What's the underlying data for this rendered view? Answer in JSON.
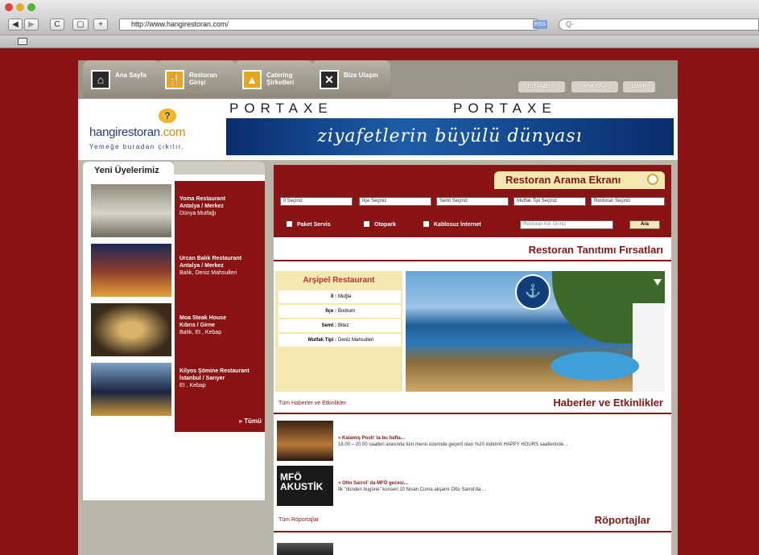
{
  "browser": {
    "url": "http://www.hangirestoran.com/",
    "search_placeholder": "Q-",
    "rss_label": "RSS",
    "back": "◀",
    "forward": "▶",
    "reload": "C",
    "add": "+"
  },
  "nav": {
    "tabs": [
      {
        "label": "Ana Sayfa",
        "icon": "home-icon",
        "glyph": "⌂"
      },
      {
        "label": "Restoran Girişi",
        "icon": "restaurant-icon",
        "glyph": "🍴"
      },
      {
        "label": "Catering Şirketleri",
        "icon": "catering-icon",
        "glyph": "▲"
      },
      {
        "label": "Bize Ulaşın",
        "icon": "contact-icon",
        "glyph": "✕"
      }
    ],
    "cities": [
      "İSTANBUL",
      "ANKARA",
      "İZMİR"
    ]
  },
  "header": {
    "logo_main": "hangirestoran",
    "logo_dot": ".com",
    "tagline": "Yemeğe buradan çıkılır.",
    "portaxe_1": "PORTAXE",
    "portaxe_2": "PORTAXE",
    "banner_text": "ziyafetlerin büyülü dünyası"
  },
  "members": {
    "title": "Yeni Üyelerimiz",
    "items": [
      {
        "name": "Yoma Restaurant",
        "location": "Antalya / Merkez",
        "cuisine": "Dünya Mutfağı"
      },
      {
        "name": "Urcan Balık Restaurant",
        "location": "Antalya / Merkez",
        "cuisine": "Balık, Deniz Mahsulleri"
      },
      {
        "name": "Moa Steak House",
        "location": "Kıbrıs / Girne",
        "cuisine": "Balık, Et , Kebap"
      },
      {
        "name": "Kilyos Şömine Restaurant",
        "location": "İstanbul / Sarıyer",
        "cuisine": "Et , Kebap"
      }
    ],
    "all_link": "» Tümü"
  },
  "search": {
    "title": "Restoran Arama Ekranı",
    "selects": [
      "İl Seçiniz",
      "İlçe Seçiniz",
      "Semt Seçiniz",
      "Mutfak Tipi Seçiniz",
      "Restoran Seçiniz"
    ],
    "checkboxes": [
      "Paket Servis",
      "Otopark",
      "Kablosuz İnternet"
    ],
    "name_placeholder": "Restoran Adı Giriniz",
    "button": "Ara"
  },
  "promo": {
    "heading": "Restoran Tanıtımı Fırsatları",
    "restaurant": "Arşipel Restaurant",
    "rows": [
      {
        "key": "İl :",
        "value": "Muğla"
      },
      {
        "key": "İlçe :",
        "value": "Bodrum"
      },
      {
        "key": "Semt :",
        "value": "Bitez"
      },
      {
        "key": "Mutfak Tipi :",
        "value": "Deniz Mahsulleri"
      }
    ]
  },
  "news": {
    "heading": "Haberler ve Etkinlikler",
    "all_link": "Tüm Haberler ve Etkinlikler",
    "items": [
      {
        "title": "» Kalamış Posh' ta bu hafta...",
        "text": "18.00 – 20.00 saatleri arasında tüm menü üzerinde geçerli olan %20 indirimli HAPPY HOURS saatlerinde..."
      },
      {
        "title": "» Otto Sarrol' da MFÖ gecesi...",
        "text": "İlk \"dünden bugüne\" konseri 10 Nisan Cuma akşamı Otto Sarrol'da ..."
      }
    ],
    "thumb2_label": "MFÖ AKUSTİK"
  },
  "interviews": {
    "heading": "Röportajlar",
    "all_link": "Tüm Röportajlar"
  }
}
